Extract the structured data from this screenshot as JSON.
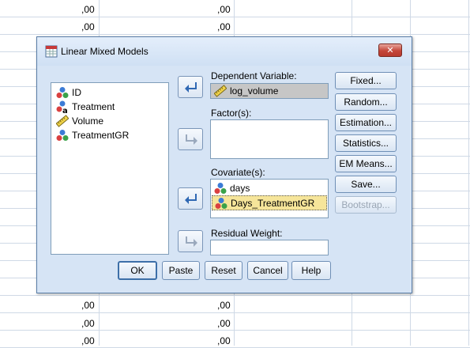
{
  "spreadsheet": {
    "cell_value": ",00"
  },
  "dialog": {
    "title": "Linear Mixed Models",
    "close_label": "✕",
    "source_variables": [
      {
        "label": "ID",
        "icon": "nominal-icon"
      },
      {
        "label": "Treatment",
        "icon": "nominal-string-icon"
      },
      {
        "label": "Volume",
        "icon": "scale-ruler-icon"
      },
      {
        "label": "TreatmentGR",
        "icon": "nominal-icon"
      }
    ],
    "dependent": {
      "label": "Dependent Variable:",
      "value": "log_volume"
    },
    "factors": {
      "label": "Factor(s):"
    },
    "covariates": {
      "label": "Covariate(s):",
      "items": [
        "days",
        "Days_TreatmentGR"
      ]
    },
    "residual_weight": {
      "label": "Residual Weight:"
    },
    "side_buttons": [
      "Fixed...",
      "Random...",
      "Estimation...",
      "Statistics...",
      "EM Means...",
      "Save...",
      "Bootstrap..."
    ],
    "bottom_buttons": [
      "OK",
      "Paste",
      "Reset",
      "Cancel",
      "Help"
    ]
  }
}
